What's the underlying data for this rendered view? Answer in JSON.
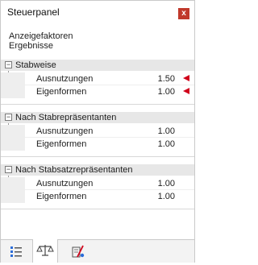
{
  "panel": {
    "title": "Steuerpanel",
    "close_glyph": "x"
  },
  "info": {
    "line1": "Anzeigefaktoren",
    "line2": "Ergebnisse"
  },
  "sections": [
    {
      "label": "Stabweise",
      "toggle": "−",
      "rows": [
        {
          "label": "Ausnutzungen",
          "value": "1.50",
          "flag": true
        },
        {
          "label": "Eigenformen",
          "value": "1.00",
          "flag": true
        }
      ]
    },
    {
      "label": "Nach Stabrepräsentanten",
      "toggle": "−",
      "rows": [
        {
          "label": "Ausnutzungen",
          "value": "1.00",
          "flag": false
        },
        {
          "label": "Eigenformen",
          "value": "1.00",
          "flag": false
        }
      ]
    },
    {
      "label": "Nach Stabsatzrepräsentanten",
      "toggle": "−",
      "rows": [
        {
          "label": "Ausnutzungen",
          "value": "1.00",
          "flag": false
        },
        {
          "label": "Eigenformen",
          "value": "1.00",
          "flag": false
        }
      ]
    }
  ],
  "tabs": [
    {
      "name": "list-icon",
      "active": false
    },
    {
      "name": "scale-balance-icon",
      "active": true
    },
    {
      "name": "member-result-icon",
      "active": false
    }
  ],
  "colors": {
    "accent_red": "#d0021b",
    "close_red": "#c0392b",
    "section_bg": "#e7e7e7"
  }
}
